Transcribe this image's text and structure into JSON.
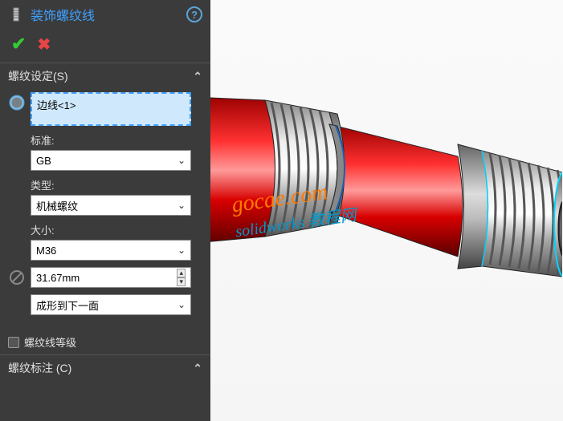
{
  "header": {
    "title": "装饰螺纹线"
  },
  "sections": {
    "settings": {
      "title": "螺纹设定(S)",
      "edge_value": "边线<1>",
      "standard_label": "标准:",
      "standard_value": "GB",
      "type_label": "类型:",
      "type_value": "机械螺纹",
      "size_label": "大小:",
      "size_value": "M36",
      "depth_value": "31.67mm",
      "end_condition": "成形到下一面",
      "grade_checkbox": "螺纹线等级"
    },
    "callout": {
      "title": "螺纹标注 (C)"
    }
  },
  "watermark": {
    "line1": "gocae.com",
    "line2": "solidworks 教程网"
  }
}
